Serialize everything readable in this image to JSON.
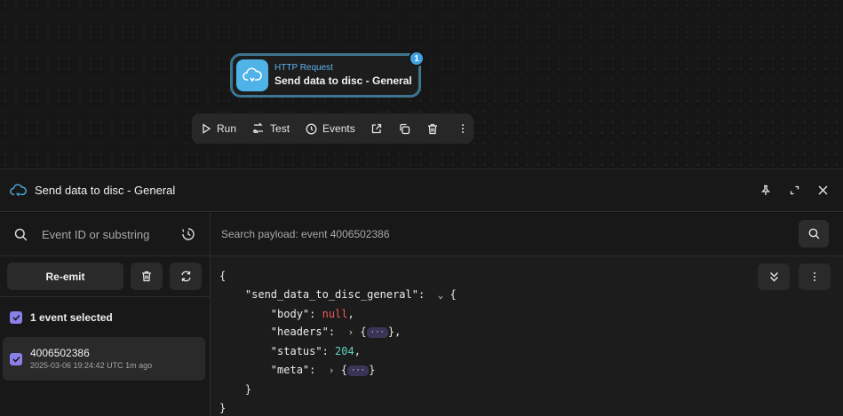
{
  "canvas": {
    "node": {
      "type_label": "HTTP Request",
      "title": "Send data to disc - General",
      "badge": "1"
    },
    "toolbar": {
      "run_label": "Run",
      "test_label": "Test",
      "events_label": "Events"
    }
  },
  "panel": {
    "title": "Send data to disc - General"
  },
  "events_list": {
    "search_placeholder": "Event ID or substring",
    "reemit_label": "Re-emit",
    "selected_label": "1 event selected",
    "items": [
      {
        "id": "4006502386",
        "meta": "2025-03-06 19:24:42 UTC 1m ago",
        "checked": true
      }
    ]
  },
  "payload": {
    "search_placeholder": "Search payload: event 4006502386",
    "json": {
      "open_brace": "{",
      "root_key": "\"send_data_to_disc_general\"",
      "body_key": "\"body\"",
      "body_value": "null",
      "headers_key": "\"headers\"",
      "status_key": "\"status\"",
      "status_value": "204",
      "meta_key": "\"meta\"",
      "ellipsis": "···",
      "inner_close": "}",
      "close_brace": "}"
    }
  },
  "colors": {
    "accent_blue": "#4fb3e8",
    "checkbox_purple": "#8b7fe8",
    "null_red": "#ef5b5b",
    "number_teal": "#5fd3b8"
  }
}
